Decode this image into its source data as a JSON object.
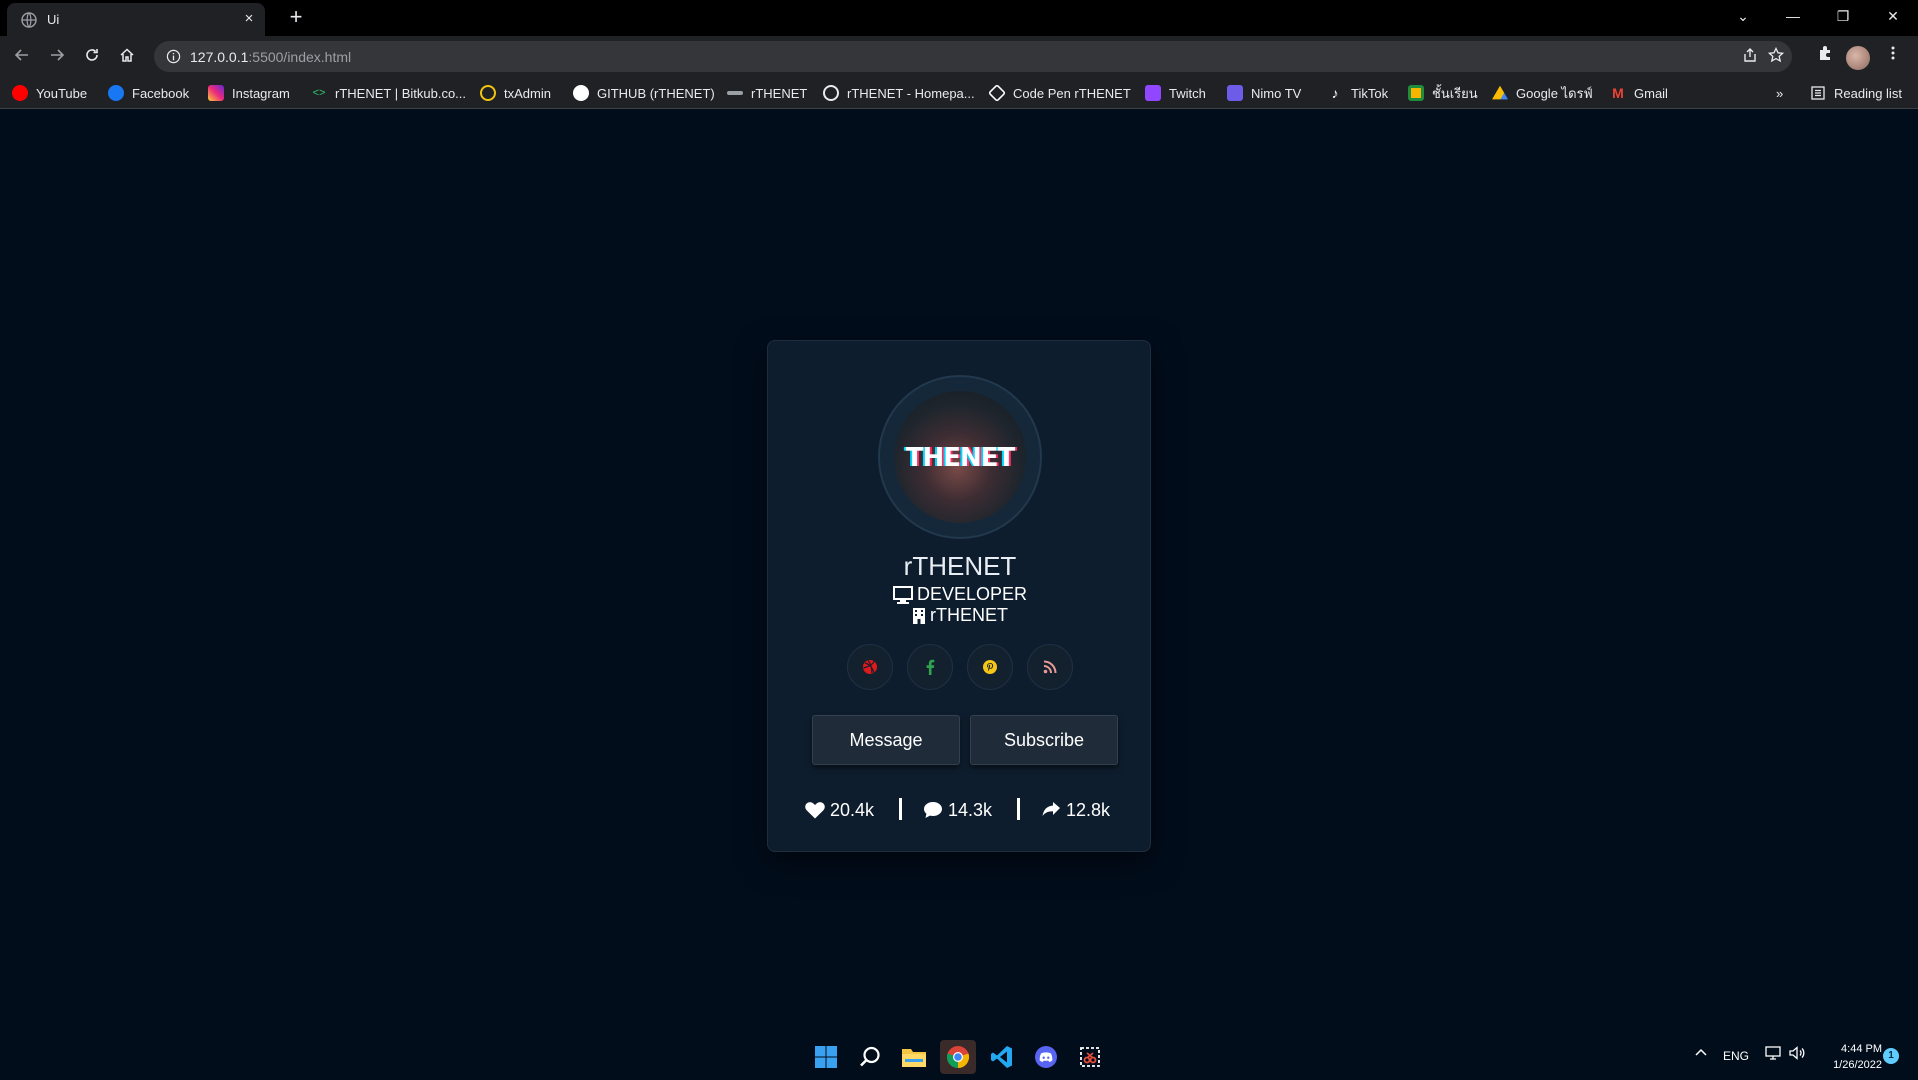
{
  "browser": {
    "tab_title": "Ui",
    "tab_close": "×",
    "new_tab": "+",
    "url_host": "127.0.0.1",
    "url_path": ":5500/index.html",
    "window_controls": {
      "tab_search": "⌄",
      "minimize": "—",
      "restore": "❐",
      "close": "✕"
    },
    "bookmarks": [
      {
        "label": "YouTube",
        "icon": "youtube-icon",
        "color": "#ff0000"
      },
      {
        "label": "Facebook",
        "icon": "facebook-icon",
        "color": "#1877f2"
      },
      {
        "label": "Instagram",
        "icon": "instagram-icon",
        "color": "#d6249f"
      },
      {
        "label": "rTHENET | Bitkub.co...",
        "icon": "code-icon",
        "color": "#2ecc71"
      },
      {
        "label": "txAdmin",
        "icon": "txadmin-icon",
        "color": "#f1c40f"
      },
      {
        "label": "GITHUB (rTHENET)",
        "icon": "github-icon",
        "color": "#ffffff"
      },
      {
        "label": "rTHENET",
        "icon": "rthenet-icon",
        "color": "#9aa0a6"
      },
      {
        "label": "rTHENET - Homepa...",
        "icon": "globe-icon",
        "color": "#e8eaed"
      },
      {
        "label": "Code Pen rTHENET",
        "icon": "codepen-icon",
        "color": "#ffffff"
      },
      {
        "label": "Twitch",
        "icon": "twitch-icon",
        "color": "#9146ff"
      },
      {
        "label": "Nimo TV",
        "icon": "nimo-icon",
        "color": "#6c5ce7"
      },
      {
        "label": "TikTok",
        "icon": "tiktok-icon",
        "color": "#ffffff"
      },
      {
        "label": "ชั้นเรียน",
        "icon": "classroom-icon",
        "color": "#f4b400"
      },
      {
        "label": "Google ไดรฟ์",
        "icon": "drive-icon",
        "color": "#34a853"
      },
      {
        "label": "Gmail",
        "icon": "gmail-icon",
        "color": "#ea4335"
      }
    ],
    "more_bookmarks": "»",
    "reading_list": "Reading list"
  },
  "profile": {
    "avatar_text": "THENET",
    "name": "rTHENET",
    "role": "DEVELOPER",
    "company": "rTHENET",
    "socials": [
      {
        "name": "dribbble-icon",
        "color": "#e0191b"
      },
      {
        "name": "facebook-icon",
        "color": "#2ea44f"
      },
      {
        "name": "pinterest-icon",
        "color": "#f5c518"
      },
      {
        "name": "rss-icon",
        "color": "#e89a95"
      }
    ],
    "buttons": {
      "message": "Message",
      "subscribe": "Subscribe"
    },
    "stats": {
      "likes": "20.4k",
      "comments": "14.3k",
      "shares": "12.8k"
    }
  },
  "taskbar": {
    "apps": [
      "start-icon",
      "search-icon",
      "file-explorer-icon",
      "chrome-icon",
      "vscode-icon",
      "discord-icon",
      "snipping-tool-icon"
    ],
    "language": "ENG",
    "time": "4:44 PM",
    "date": "1/26/2022",
    "notifications": "1"
  }
}
